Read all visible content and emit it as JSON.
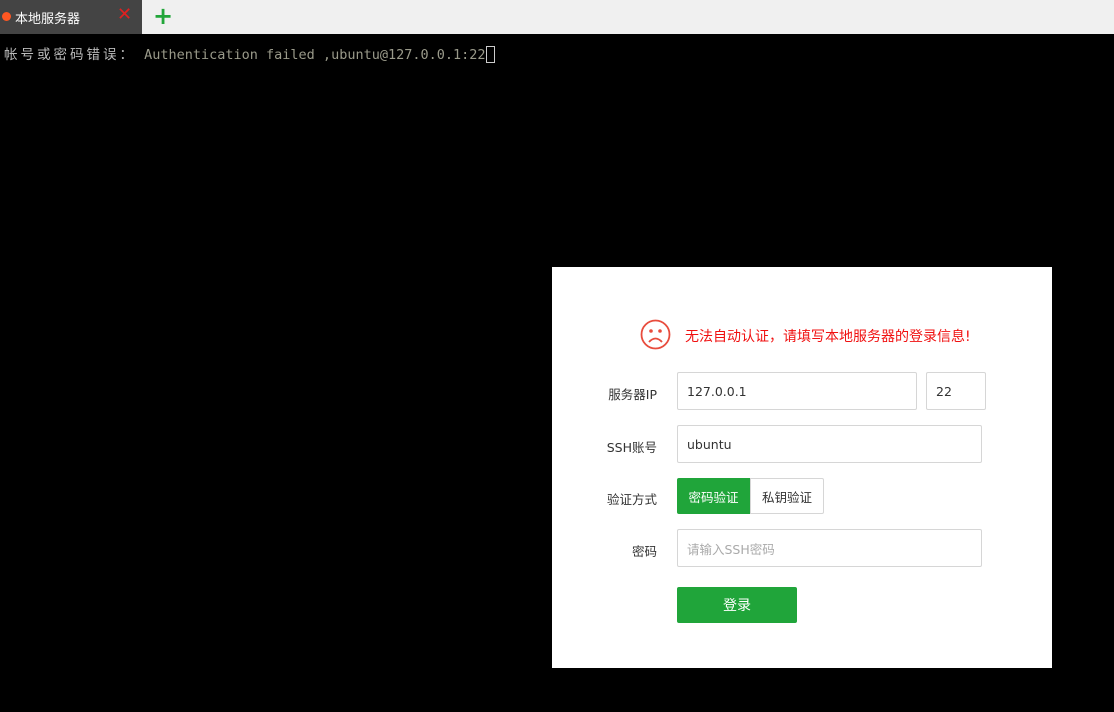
{
  "tabs": [
    {
      "label": "本地服务器",
      "status_color": "#ff5722"
    }
  ],
  "terminal": {
    "error_cn": "帐号或密码错误：",
    "error_en": " Authentication failed ,ubuntu@127.0.0.1:22"
  },
  "dialog": {
    "message": "无法自动认证，请填写本地服务器的登录信息!",
    "server_ip_label": "服务器IP",
    "server_ip": "127.0.0.1",
    "port": "22",
    "ssh_account_label": "SSH账号",
    "ssh_account": "ubuntu",
    "auth_method_label": "验证方式",
    "auth_methods": [
      "密码验证",
      "私钥验证"
    ],
    "auth_selected": "密码验证",
    "password_label": "密码",
    "password_placeholder": "请输入SSH密码",
    "login_label": "登录",
    "accent": "#20a53a",
    "error_color": "#f01010"
  }
}
